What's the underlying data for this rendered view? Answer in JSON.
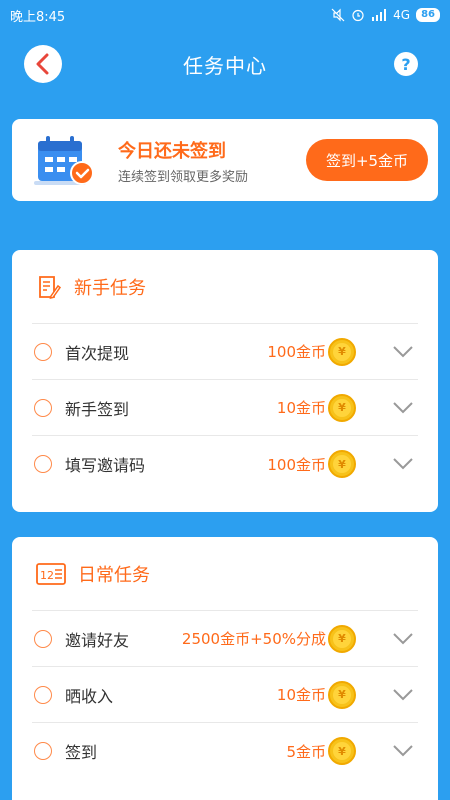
{
  "statusbar": {
    "time": "晚上8:45",
    "network": "4G",
    "battery": "86"
  },
  "header": {
    "title": "任务中心",
    "help": "?"
  },
  "signin": {
    "title": "今日还未签到",
    "subtitle": "连续签到领取更多奖励",
    "button_label": "签到+5金币"
  },
  "coin_symbol": "¥",
  "newbie": {
    "title": "新手任务",
    "tasks": [
      {
        "name": "首次提现",
        "reward": "100金币"
      },
      {
        "name": "新手签到",
        "reward": "10金币"
      },
      {
        "name": "填写邀请码",
        "reward": "100金币"
      }
    ]
  },
  "daily": {
    "title": "日常任务",
    "icon_text": "12",
    "tasks": [
      {
        "name": "邀请好友",
        "reward": "2500金币+50%分成"
      },
      {
        "name": "晒收入",
        "reward": "10金币"
      },
      {
        "name": "签到",
        "reward": "5金币"
      }
    ]
  },
  "colors": {
    "background": "#2c9ff0",
    "accent": "#ff6a1a"
  }
}
